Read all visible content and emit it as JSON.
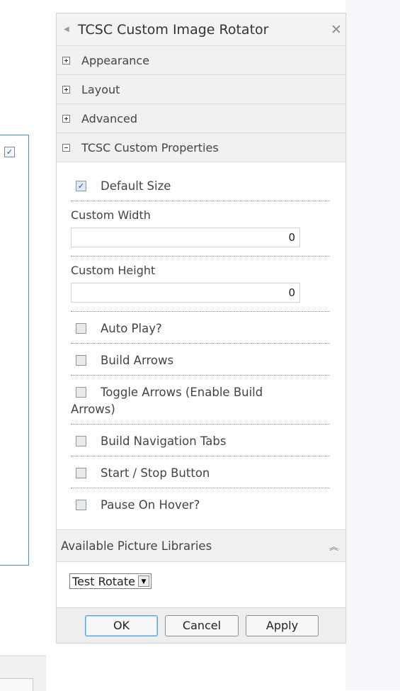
{
  "pane": {
    "title": "TCSC Custom Image Rotator",
    "close_glyph": "✕"
  },
  "sections": [
    {
      "label": "Appearance",
      "state": "collapsed"
    },
    {
      "label": "Layout",
      "state": "collapsed"
    },
    {
      "label": "Advanced",
      "state": "collapsed"
    },
    {
      "label": "TCSC Custom Properties",
      "state": "expanded"
    }
  ],
  "props": {
    "default_size": {
      "label": "Default Size",
      "checked": true
    },
    "custom_width": {
      "label": "Custom Width",
      "value": "0"
    },
    "custom_height": {
      "label": "Custom Height",
      "value": "0"
    },
    "auto_play": {
      "label": "Auto Play?",
      "checked": false
    },
    "build_arrows": {
      "label": "Build Arrows",
      "checked": false
    },
    "toggle_arrows": {
      "label_line1": "Toggle Arrows (Enable Build",
      "label_line2": "Arrows)",
      "checked": false
    },
    "build_nav_tabs": {
      "label": "Build Navigation Tabs",
      "checked": false
    },
    "start_stop": {
      "label": "Start / Stop Button",
      "checked": false
    },
    "pause_hover": {
      "label": "Pause On Hover?",
      "checked": false
    }
  },
  "libraries": {
    "header": "Available Picture Libraries",
    "selected": "Test Rotate"
  },
  "footer": {
    "ok": "OK",
    "cancel": "Cancel",
    "apply": "Apply"
  },
  "icons": {
    "check": "✓",
    "collapse": "⌃",
    "dropdown": "▼"
  },
  "colors": {
    "accent_border": "#3d8fc4",
    "dotted_separator": "#6f8fb6",
    "section_bg": "#f1f1f1"
  }
}
